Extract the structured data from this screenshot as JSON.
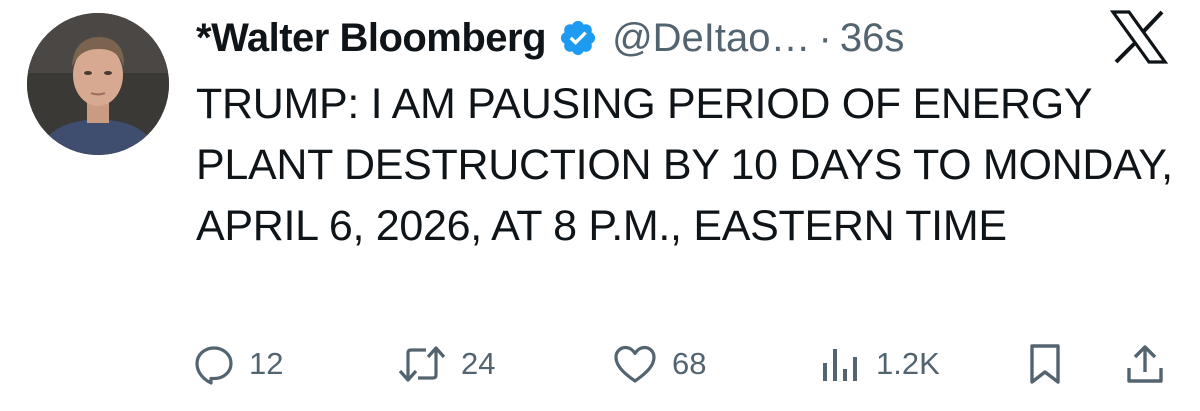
{
  "tweet": {
    "author_name": "*Walter Bloomberg",
    "handle": "@DeItao…",
    "separator": "·",
    "time": "36s",
    "text": "TRUMP: I AM PAUSING PERIOD OF ENERGY PLANT DESTRUCTION BY 10 DAYS TO MONDAY, APRIL 6, 2026, AT 8 P.M., EASTERN TIME"
  },
  "actions": {
    "replies": "12",
    "retweets": "24",
    "likes": "68",
    "views": "1.2K"
  },
  "colors": {
    "text": "#0f1419",
    "muted": "#536471",
    "verified_blue": "#1d9bf0"
  },
  "icons": {
    "verified": "verified-badge-icon",
    "platform": "x-logo-icon",
    "reply": "reply-icon",
    "retweet": "retweet-icon",
    "like": "heart-icon",
    "views": "views-icon",
    "bookmark": "bookmark-icon",
    "share": "share-icon"
  }
}
